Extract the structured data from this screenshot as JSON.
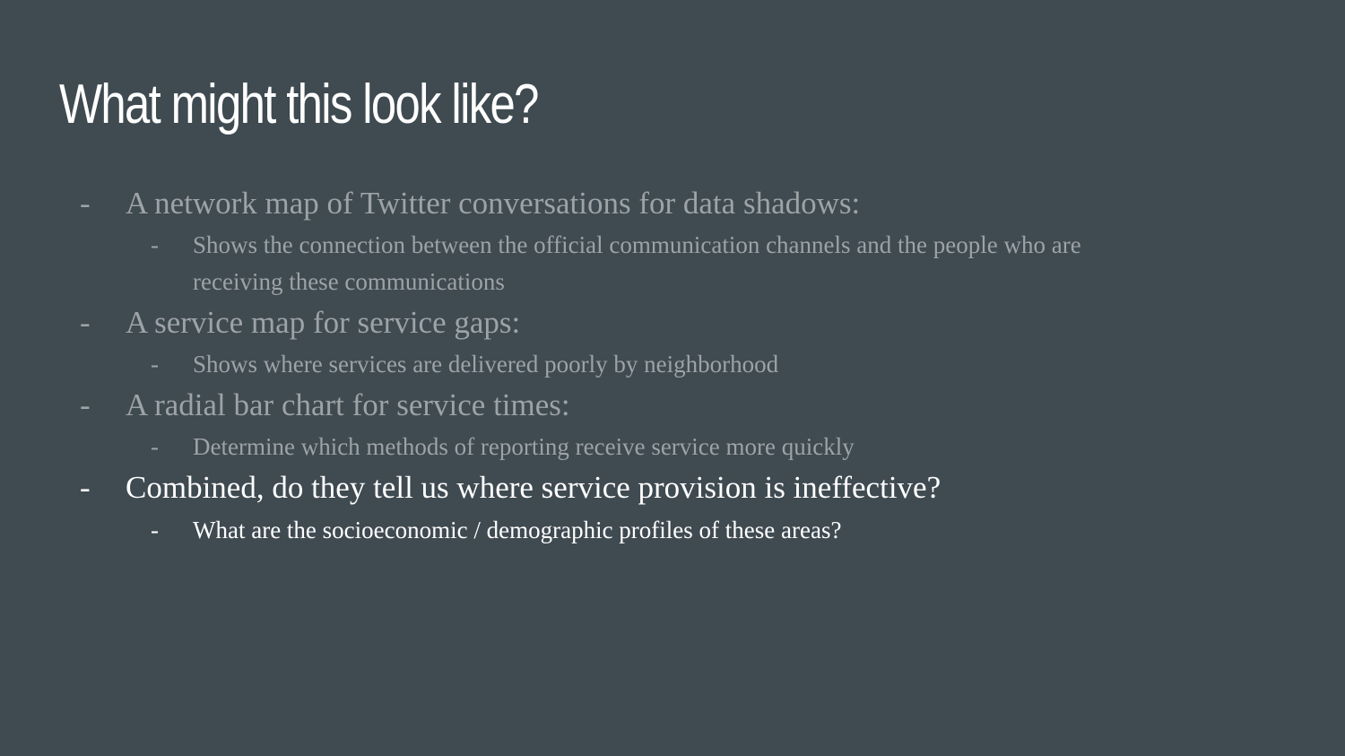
{
  "slide": {
    "title": "What might this look like?",
    "bullets": [
      {
        "dash": "-",
        "text": "A network map of Twitter conversations for data shadows:",
        "sub": [
          {
            "dash": "-",
            "text_line1": "Shows the connection between the official communication channels and the people who are",
            "text_line2": "receiving these communications"
          }
        ]
      },
      {
        "dash": "-",
        "text": "A service map for service gaps:",
        "sub": [
          {
            "dash": "-",
            "text_line1": "Shows where services are delivered poorly by neighborhood"
          }
        ]
      },
      {
        "dash": "-",
        "text": "A radial bar chart for service times:",
        "sub": [
          {
            "dash": "-",
            "text_line1": "Determine which methods of reporting receive service more quickly"
          }
        ]
      },
      {
        "dash": "-",
        "text": "Combined, do they tell us where service provision is ineffective?",
        "sub": [
          {
            "dash": "-",
            "text_line1": "What are the socioeconomic / demographic profiles of these areas?"
          }
        ]
      }
    ]
  },
  "colors": {
    "background": "#3f4a51",
    "title": "#ffffff",
    "dimmed_text": "#9da3a7",
    "highlighted_text": "#ffffff"
  }
}
